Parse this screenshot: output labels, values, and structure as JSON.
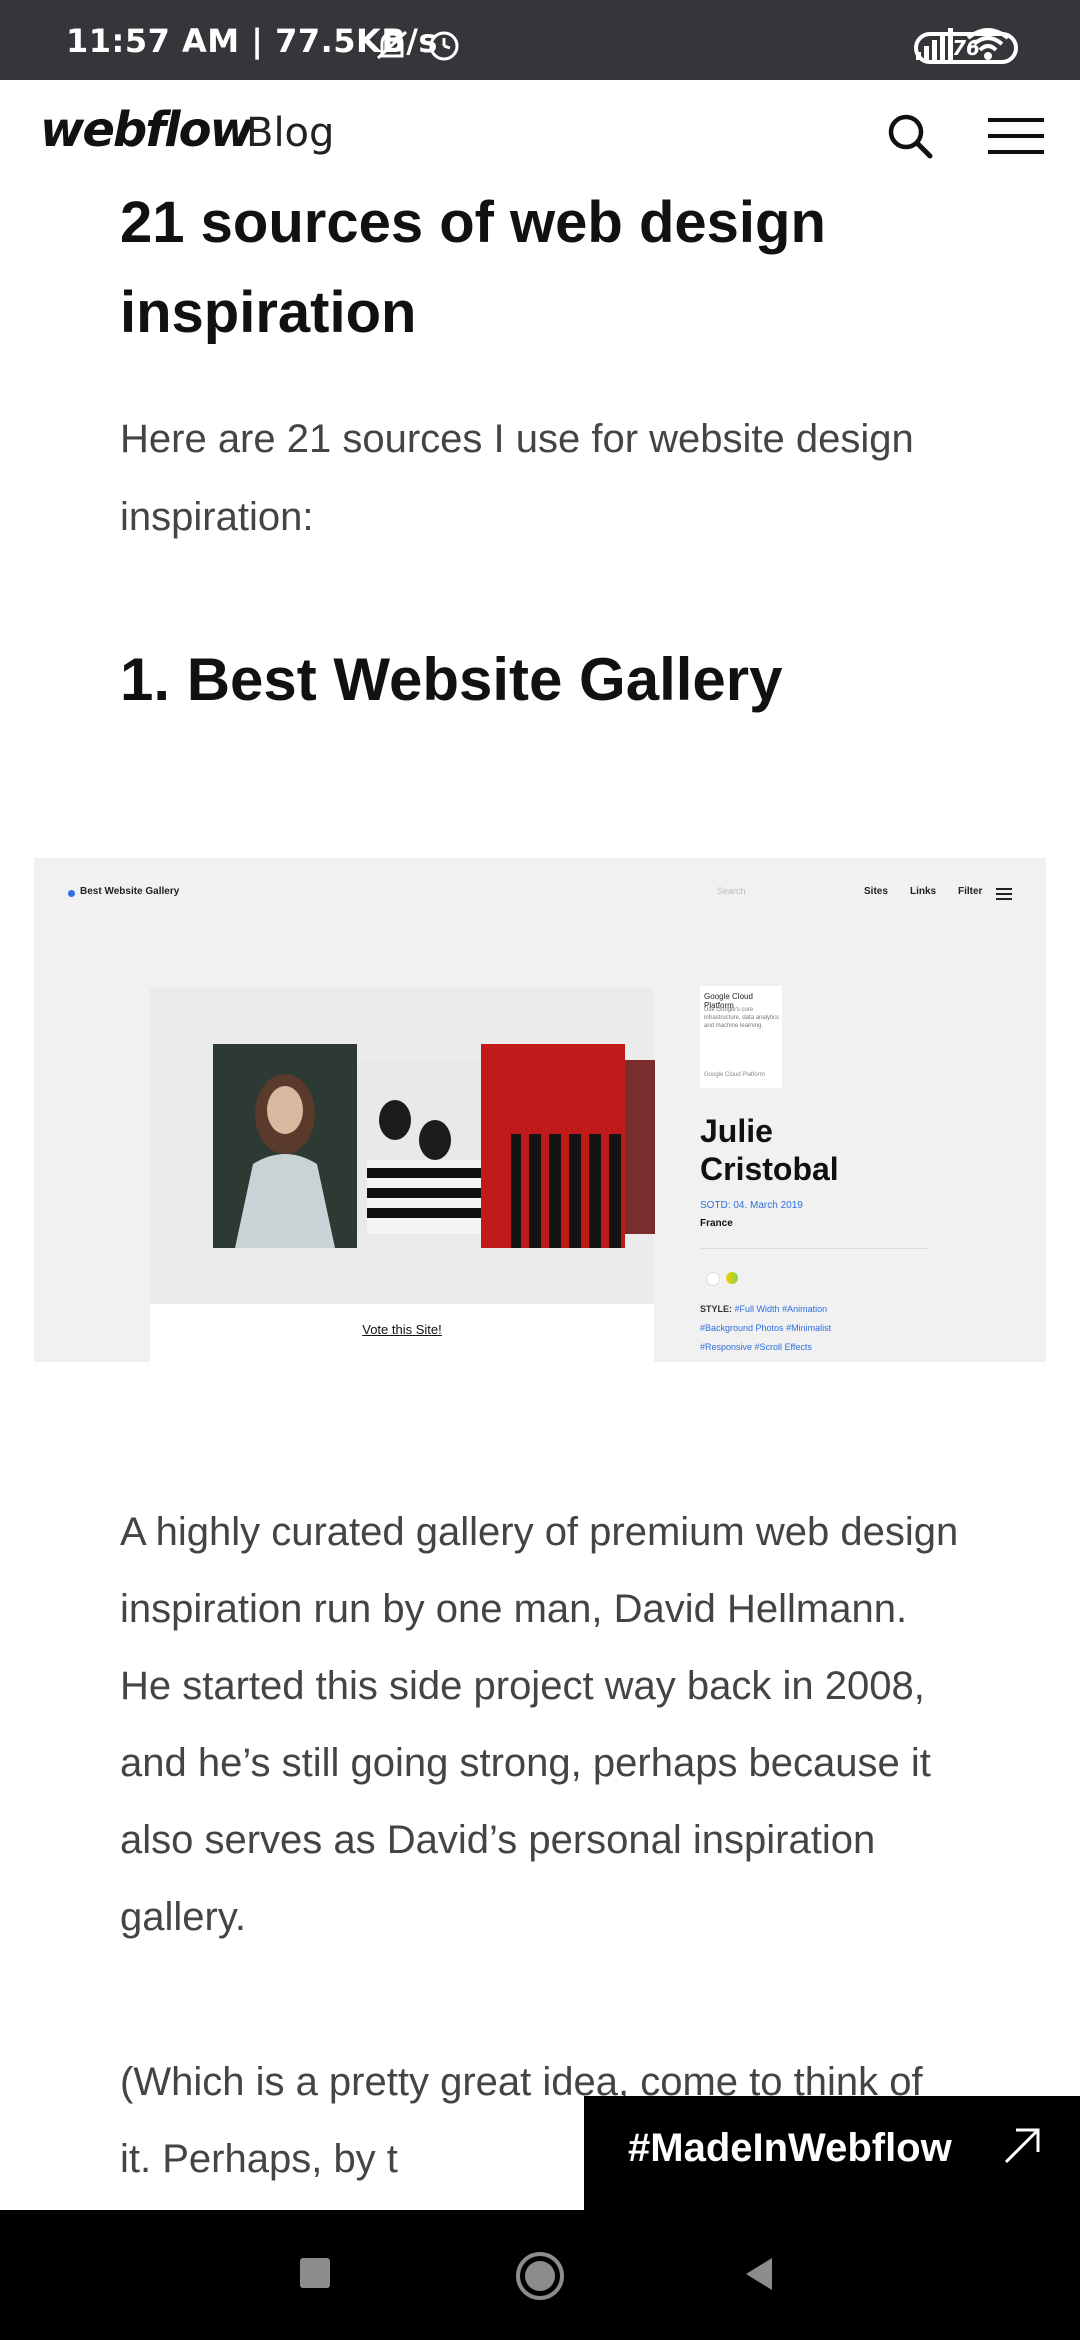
{
  "status_bar": {
    "time": "11:57 AM | 77.5KB/s",
    "battery": "76"
  },
  "header": {
    "logo": "webflow",
    "blog_label": "Blog"
  },
  "article": {
    "title": "21 sources of web design inspiration",
    "intro": "Here are 21 sources I use for website design inspiration:",
    "section_heading": "1. Best Website Gallery",
    "paragraph1": "A highly curated gallery of premium web design inspiration run by one man, David Hellmann. He started this side project way back in 2008, and he’s still going strong, perhaps because it also serves as David’s personal inspiration gallery.",
    "paragraph2": "(Which is a pretty great idea, come to think of it. Perhaps, by t"
  },
  "screenshot": {
    "brand": "Best Website Gallery",
    "search_placeholder": "Search",
    "nav": [
      "Sites",
      "Links",
      "Filter"
    ],
    "ad_title": "Google Cloud Platform",
    "ad_body": "Use Google's core infrastructure, data analytics and machine learning.",
    "ad_footer": "Google Cloud Platform",
    "site_name_line1": "Julie",
    "site_name_line2": "Cristobal",
    "sotd": "SOTD: 04. March 2019",
    "country": "France",
    "style_label": "STYLE:",
    "style_tags": [
      "#Full Width",
      "#Animation",
      "#Background Photos",
      "#Minimalist",
      "#Responsive",
      "#Scroll Effects"
    ],
    "vote_link": "Vote this Site!"
  },
  "badge": {
    "label": "#MadeInWebflow"
  },
  "colors": {
    "status_bar_bg": "#35363a",
    "accent": "#4353ff",
    "link_blue": "#2f6fe0",
    "badge_bg": "#000000"
  }
}
